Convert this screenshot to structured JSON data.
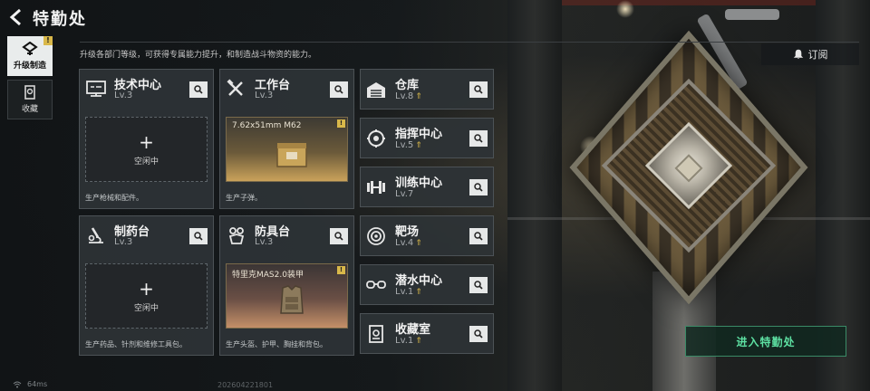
{
  "header": {
    "title": "特勤处"
  },
  "rail": [
    {
      "label": "升级制造",
      "active": true,
      "badge": "!"
    },
    {
      "label": "收藏",
      "active": false
    }
  ],
  "intro": "升级各部门等级，可获得专属能力提升，和制造战斗物资的能力。",
  "subscribe_label": "订阅",
  "big_cards": [
    {
      "name": "技术中心",
      "level": "Lv.3",
      "slot": "空闲中",
      "plus": "+",
      "desc": "生产枪械和配件。"
    },
    {
      "name": "工作台",
      "level": "Lv.3",
      "product": "7.62x51mm M62",
      "flag": "!",
      "desc": "生产子弹。"
    },
    {
      "name": "制药台",
      "level": "Lv.3",
      "slot": "空闲中",
      "plus": "+",
      "desc": "生产药品、针剂和维修工具包。"
    },
    {
      "name": "防具台",
      "level": "Lv.3",
      "product": "特里克MAS2.0装甲",
      "flag": "!",
      "desc": "生产头盔、护甲、胸挂和背包。"
    }
  ],
  "small_cards": [
    {
      "name": "仓库",
      "level": "Lv.8",
      "upgrade": "⇑"
    },
    {
      "name": "指挥中心",
      "level": "Lv.5",
      "upgrade": "⇑"
    },
    {
      "name": "训练中心",
      "level": "Lv.7",
      "upgrade": ""
    },
    {
      "name": "靶场",
      "level": "Lv.4",
      "upgrade": "⇑"
    },
    {
      "name": "潜水中心",
      "level": "Lv.1",
      "upgrade": "⇑"
    },
    {
      "name": "收藏室",
      "level": "Lv.1",
      "upgrade": "⇑"
    }
  ],
  "enter_button": "进入特勤处",
  "footer": {
    "ping": "64ms",
    "build": "202604221801"
  },
  "colors": {
    "accent_gold": "#d9b84a",
    "enter_green": "#5de0a2"
  }
}
